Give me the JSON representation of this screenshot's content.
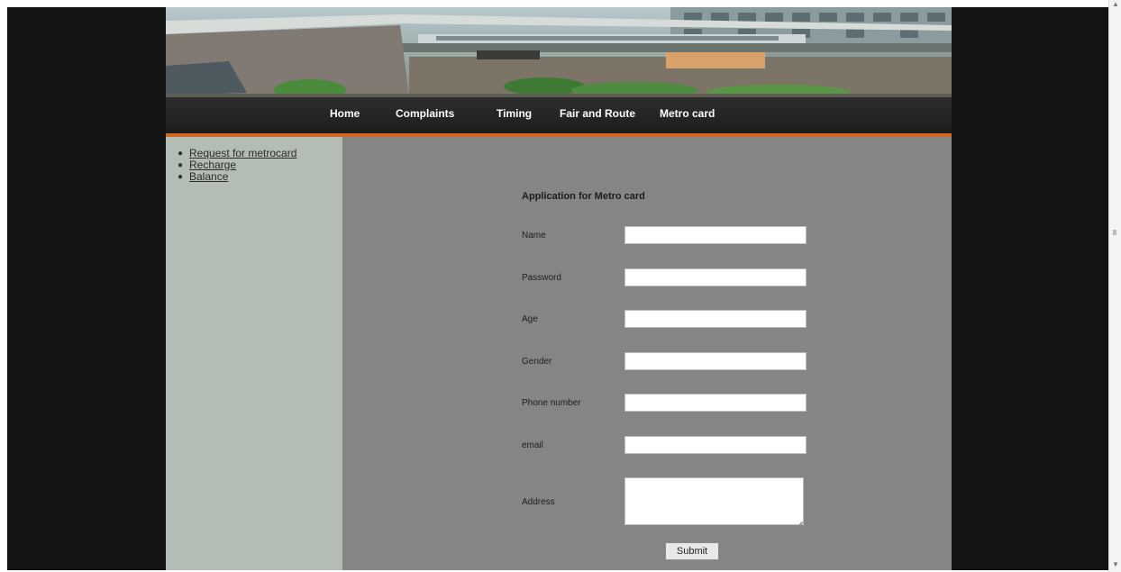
{
  "nav": {
    "items": [
      {
        "label": "Home"
      },
      {
        "label": "Complaints"
      },
      {
        "label": "Timing"
      },
      {
        "label": "Fair and Route"
      },
      {
        "label": "Metro card"
      }
    ]
  },
  "sidebar": {
    "items": [
      {
        "label": "Request for metrocard"
      },
      {
        "label": "Recharge"
      },
      {
        "label": "Balance"
      }
    ]
  },
  "form": {
    "title": "Application for Metro card",
    "fields": {
      "name": {
        "label": "Name",
        "value": ""
      },
      "password": {
        "label": "Password",
        "value": ""
      },
      "age": {
        "label": "Age",
        "value": ""
      },
      "gender": {
        "label": "Gender",
        "value": ""
      },
      "phone": {
        "label": "Phone number",
        "value": ""
      },
      "email": {
        "label": "email",
        "value": ""
      },
      "address": {
        "label": "Address",
        "value": ""
      }
    },
    "submit_label": "Submit"
  },
  "colors": {
    "page_background": "#141414",
    "navbar": "#222222",
    "navbar_accent": "#d2691e",
    "sidebar": "#b4bdb5",
    "main": "#858585"
  }
}
